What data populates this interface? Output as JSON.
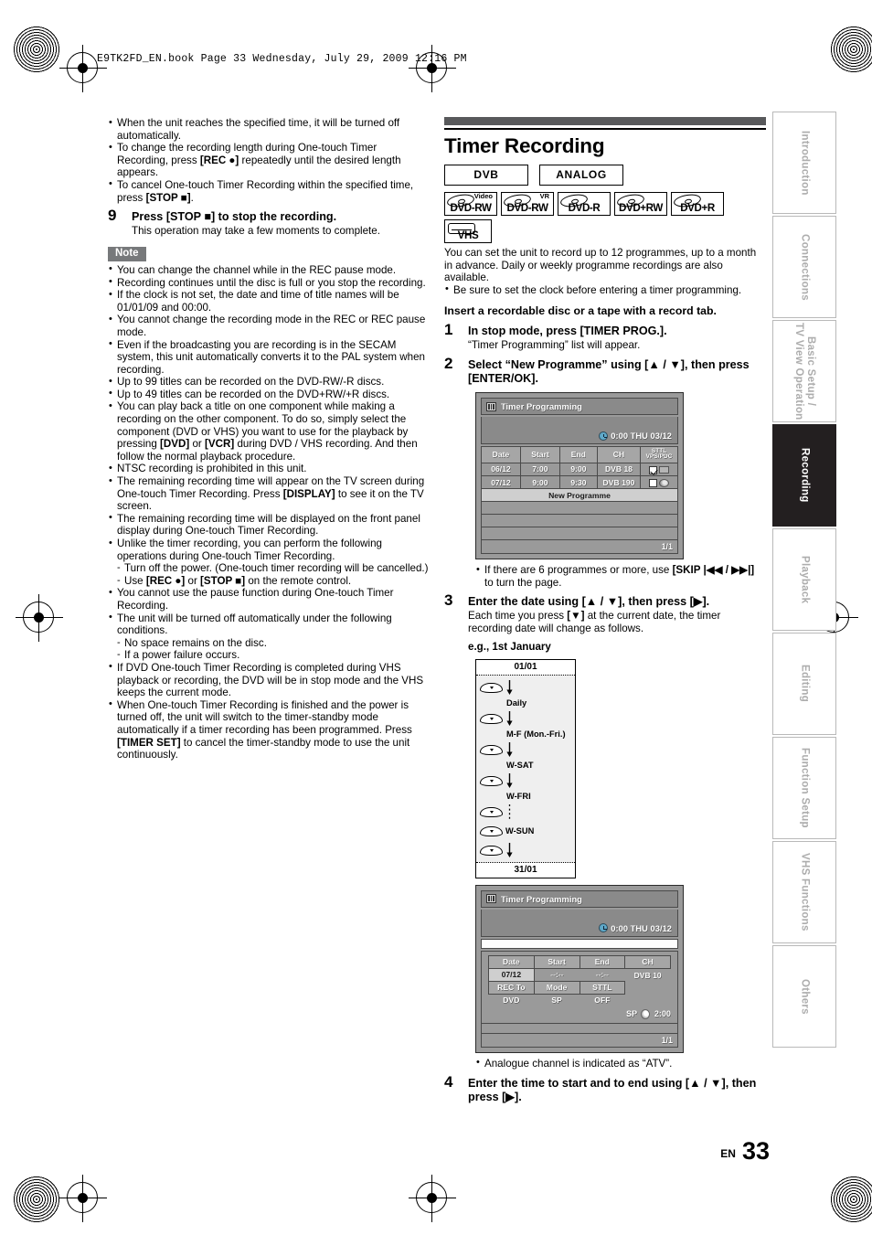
{
  "header": {
    "text": "E9TK2FD_EN.book   Page 33   Wednesday,  July 29,  2009   12:16 PM"
  },
  "left_column": {
    "top_bullets": [
      "When the unit reaches the specified time, it will be turned off automatically.",
      "To change the recording length during One-touch Timer Recording, press [REC ●] repeatedly until the desired length appears.",
      "To cancel One-touch Timer Recording within the specified time, press [STOP ■]."
    ],
    "step9": {
      "number": "9",
      "heading": "Press [STOP ■] to stop the recording.",
      "sub": "This operation may take a few moments to complete."
    },
    "note_label": "Note",
    "note_bullets": [
      "You can change the channel while in the REC pause mode.",
      "Recording continues until the disc is full or you stop the recording.",
      "If the clock is not set, the date and time of title names will be 01/01/09 and 00:00.",
      "You cannot change the recording mode in the REC or REC pause mode.",
      "Even if the broadcasting you are recording is in the SECAM system, this unit automatically converts it to the PAL system when recording.",
      "Up to 99 titles can be recorded on the DVD-RW/-R discs.",
      "Up to 49 titles can be recorded on the DVD+RW/+R discs.",
      "You can play back a title on one component while making a recording on the other component. To do so, simply select the component (DVD or VHS) you want to use for the playback by pressing [DVD] or [VCR] during DVD / VHS recording. And then follow the normal playback procedure.",
      "NTSC recording is prohibited in this unit.",
      "The remaining recording time will appear on the TV screen during One-touch Timer Recording. Press [DISPLAY] to see it on the TV screen.",
      "The remaining recording time will be displayed on the front panel display during One-touch Timer Recording.",
      "Unlike the timer recording, you can perform the following operations during One-touch Timer Recording.",
      "Turn off the power. (One-touch timer recording will be cancelled.)",
      "Use [REC ●] or [STOP ■] on the remote control.",
      "You cannot use the pause function during One-touch Timer Recording.",
      "The unit will be turned off automatically under the following conditions.",
      "No space remains on the disc.",
      "If a power failure occurs.",
      "If DVD One-touch Timer Recording is completed during VHS playback or recording, the DVD will be in stop mode and the VHS keeps the current mode.",
      "When One-touch Timer Recording is finished and the power is turned off, the unit will switch to the timer-standby mode automatically if a timer recording has been programmed. Press [TIMER SET] to cancel the timer-standby mode to use the unit continuously."
    ]
  },
  "right_column": {
    "section_title": "Timer Recording",
    "mode_pills": [
      "DVB",
      "ANALOG"
    ],
    "disc_badges": [
      {
        "label": "DVD-RW",
        "sup": "Video",
        "icon": "dvd-disc-icon"
      },
      {
        "label": "DVD-RW",
        "sup": "VR",
        "icon": "dvd-disc-icon"
      },
      {
        "label": "DVD-R",
        "sup": "",
        "icon": "dvd-disc-icon"
      },
      {
        "label": "DVD+RW",
        "sup": "",
        "icon": "dvd-disc-icon"
      },
      {
        "label": "DVD+R",
        "sup": "",
        "icon": "dvd-disc-icon"
      },
      {
        "label": "VHS",
        "sup": "",
        "icon": "vhs-tape-icon"
      }
    ],
    "intro_paragraph": "You can set the unit to record up to 12 programmes, up to a month in advance. Daily or weekly programme recordings are also available.",
    "intro_bullet": "Be sure to set the clock before entering a timer programming.",
    "insert_line": "Insert a recordable disc or a tape with a record tab.",
    "step1": {
      "number": "1",
      "heading": "In stop mode, press [TIMER PROG.].",
      "sub": "“Timer Programming” list will appear."
    },
    "step2": {
      "number": "2",
      "heading": "Select “New Programme” using [▲ / ▼], then press [ENTER/OK]."
    },
    "after_osd1_bullet": "If there are 6 programmes or more, use [SKIP |◀◀ / ▶▶|] to turn the page.",
    "step3": {
      "number": "3",
      "heading": "Enter the date using [▲ / ▼], then press [▶].",
      "sub": "Each time you press [▼] at the current date, the timer recording date will change as follows.",
      "eg": "e.g., 1st January"
    },
    "after_osd2_bullet": "Analogue channel is indicated as “ATV”.",
    "step4": {
      "number": "4",
      "heading": "Enter the time to start and to end using [▲ / ▼], then press [▶]."
    }
  },
  "osd1": {
    "title": "Timer Programming",
    "clock": "0:00 THU 03/12",
    "headers": [
      "Date",
      "Start",
      "End",
      "CH",
      "STTL",
      "VPS/PDC"
    ],
    "rows": [
      {
        "date": "06/12",
        "start": "7:00",
        "end": "9:00",
        "ch": "DVB 18",
        "sttl": "checked",
        "media": "dvd-icon"
      },
      {
        "date": "07/12",
        "start": "9:00",
        "end": "9:30",
        "ch": "DVB 190",
        "sttl": "unchecked",
        "media": "vhs-icon"
      }
    ],
    "new_programme": "New Programme",
    "page": "1/1"
  },
  "osd2": {
    "title": "Timer Programming",
    "clock": "0:00 THU 03/12",
    "headers_top": [
      "Date",
      "Start",
      "End",
      "CH"
    ],
    "row_top": {
      "date": "07/12",
      "start": "--:--",
      "end": "--:--",
      "ch": "DVB 10"
    },
    "headers_bottom": [
      "REC To",
      "Mode",
      "STTL"
    ],
    "row_bottom": {
      "rec_to": "DVD",
      "mode": "SP",
      "sttl": "OFF"
    },
    "remain": {
      "mode": "SP",
      "time": "2:00"
    },
    "page": "1/1"
  },
  "cycle_diagram": {
    "top": "01/01",
    "bottom": "31/01",
    "steps": [
      "Daily",
      "M-F (Mon.-Fri.)",
      "W-SAT",
      "W-FRI",
      "W-SUN"
    ]
  },
  "side_tabs": [
    {
      "label": "Introduction",
      "active": false
    },
    {
      "label": "Connections",
      "active": false
    },
    {
      "label": "Basic Setup /\nTV View Operation",
      "active": false
    },
    {
      "label": "Recording",
      "active": true
    },
    {
      "label": "Playback",
      "active": false
    },
    {
      "label": "Editing",
      "active": false
    },
    {
      "label": "Function Setup",
      "active": false
    },
    {
      "label": "VHS Functions",
      "active": false
    },
    {
      "label": "Others",
      "active": false
    }
  ],
  "footer": {
    "lang": "EN",
    "page": "33"
  }
}
